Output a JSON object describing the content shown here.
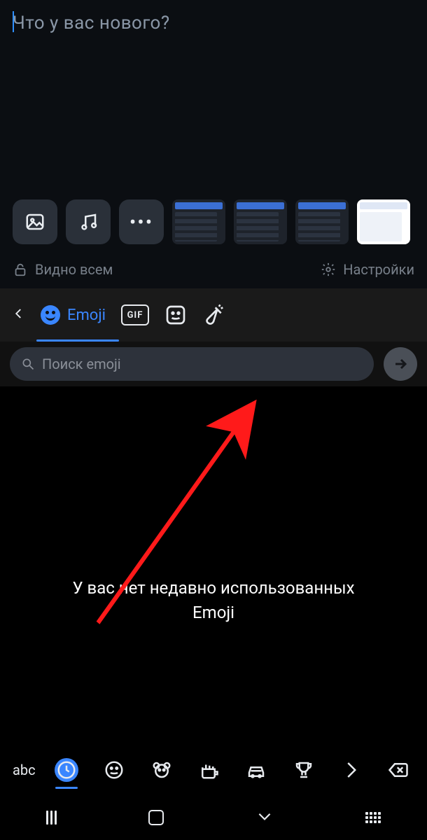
{
  "composer": {
    "placeholder": "Что у вас нового?"
  },
  "privacy": {
    "visibility_label": "Видно всем",
    "settings_label": "Настройки"
  },
  "keyboard": {
    "tab_emoji_label": "Emoji",
    "gif_label": "GIF",
    "search_placeholder": "Поиск emoji",
    "empty_message_line1": "У вас нет недавно использованных",
    "empty_message_line2": "Emoji",
    "abc_label": "abc"
  }
}
